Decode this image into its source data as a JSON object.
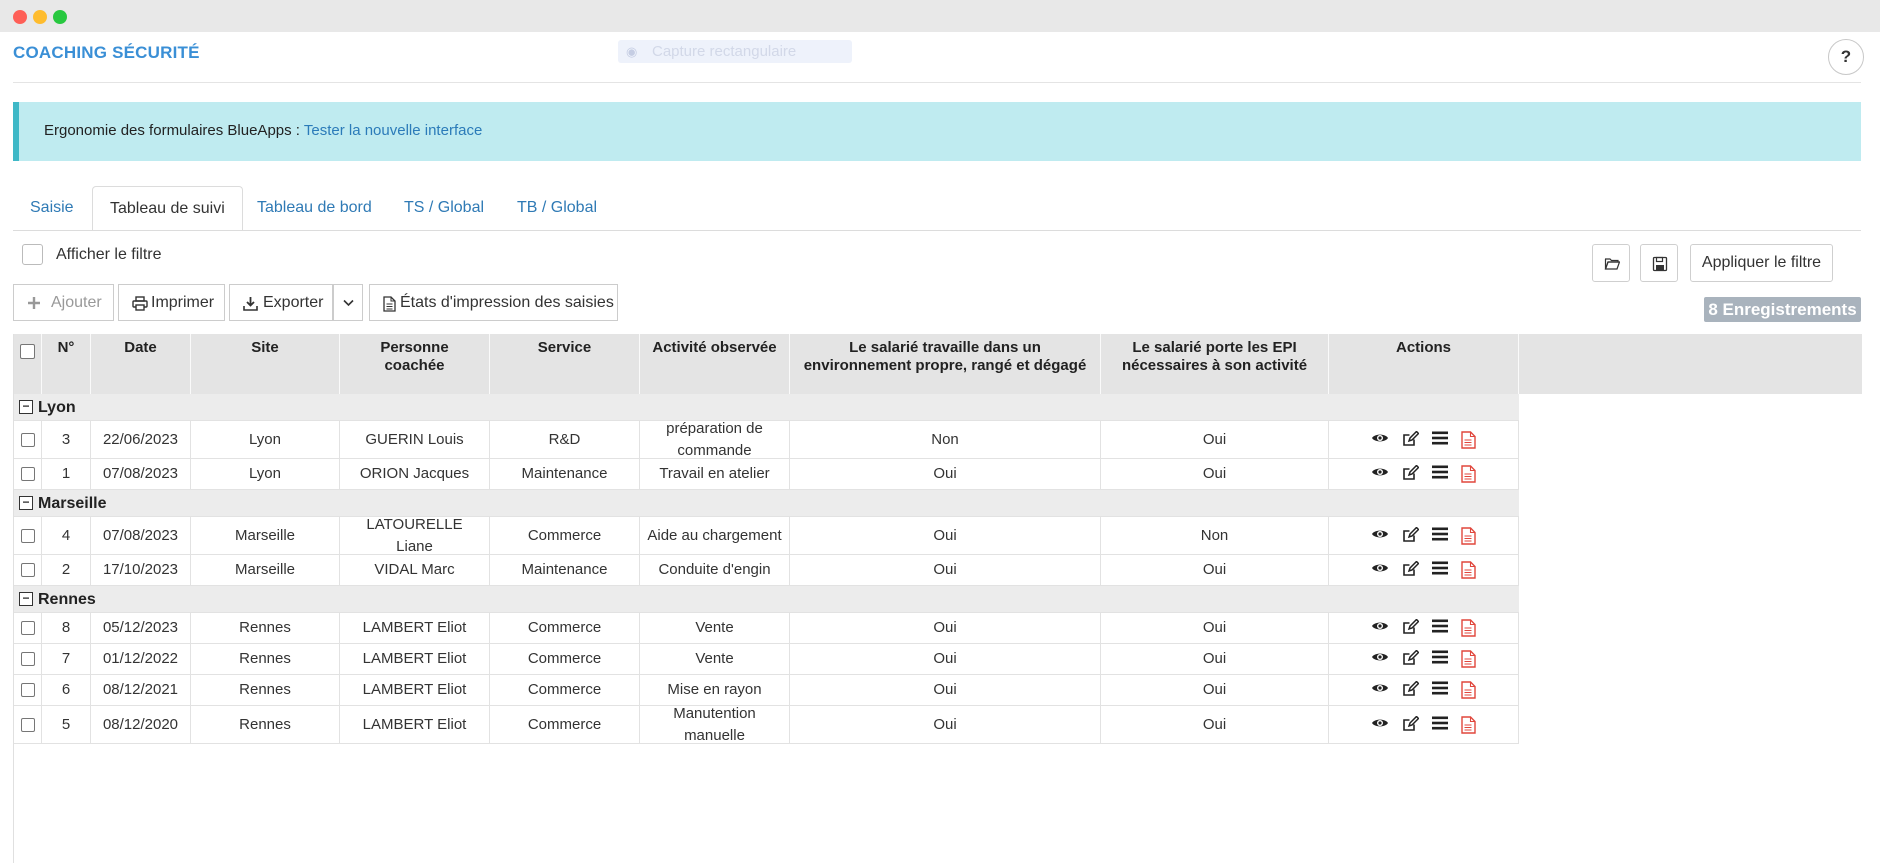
{
  "window": {
    "app_title": "COACHING SÉCURITÉ",
    "capture_text": "Capture rectangulaire",
    "help_label": "?"
  },
  "banner": {
    "label": "Ergonomie des formulaires BlueApps : ",
    "link": "Tester la nouvelle interface"
  },
  "tabs": [
    {
      "label": "Saisie",
      "active": false
    },
    {
      "label": "Tableau de suivi",
      "active": true
    },
    {
      "label": "Tableau de bord",
      "active": false
    },
    {
      "label": "TS / Global",
      "active": false
    },
    {
      "label": "TB / Global",
      "active": false
    }
  ],
  "filter": {
    "toggle_label": "Afficher le filtre",
    "apply_label": "Appliquer le filtre"
  },
  "toolbar": {
    "add_label": "Ajouter",
    "print_label": "Imprimer",
    "export_label": "Exporter",
    "states_label": "États d'impression des saisies",
    "count_label": "8 Enregistrements"
  },
  "table": {
    "headers": [
      "N°",
      "Date",
      "Site",
      "Personne coachée",
      "Service",
      "Activité observée",
      "Le salarié travaille dans un environnement propre, rangé et dégagé",
      "Le salarié porte les EPI nécessaires à son activité",
      "Actions"
    ],
    "groups": [
      {
        "name": "Lyon",
        "rows": [
          [
            "3",
            "22/06/2023",
            "Lyon",
            "GUERIN Louis",
            "R&D",
            "préparation de commande",
            "Non",
            "Oui"
          ],
          [
            "1",
            "07/08/2023",
            "Lyon",
            "ORION Jacques",
            "Maintenance",
            "Travail en atelier",
            "Oui",
            "Oui"
          ]
        ]
      },
      {
        "name": "Marseille",
        "rows": [
          [
            "4",
            "07/08/2023",
            "Marseille",
            "LATOURELLE Liane",
            "Commerce",
            "Aide au chargement",
            "Oui",
            "Non"
          ],
          [
            "2",
            "17/10/2023",
            "Marseille",
            "VIDAL Marc",
            "Maintenance",
            "Conduite d'engin",
            "Oui",
            "Oui"
          ]
        ]
      },
      {
        "name": "Rennes",
        "rows": [
          [
            "8",
            "05/12/2023",
            "Rennes",
            "LAMBERT Eliot",
            "Commerce",
            "Vente",
            "Oui",
            "Oui"
          ],
          [
            "7",
            "01/12/2022",
            "Rennes",
            "LAMBERT Eliot",
            "Commerce",
            "Vente",
            "Oui",
            "Oui"
          ],
          [
            "6",
            "08/12/2021",
            "Rennes",
            "LAMBERT Eliot",
            "Commerce",
            "Mise en rayon",
            "Oui",
            "Oui"
          ],
          [
            "5",
            "08/12/2020",
            "Rennes",
            "LAMBERT Eliot",
            "Commerce",
            "Manutention manuelle",
            "Oui",
            "Oui"
          ]
        ]
      }
    ],
    "row_actions": [
      "eye-icon",
      "edit-icon",
      "menu-icon",
      "pdf-icon"
    ]
  },
  "colors": {
    "accent": "#3a8fd6",
    "link": "#2f7ab5",
    "banner_bg": "#bfebf0",
    "banner_border": "#3fb8c7",
    "header_bg": "#e4e4e4",
    "group_bg": "#ececec",
    "badge_bg": "#a9b3bd",
    "pdf_icon": "#e0463c"
  }
}
